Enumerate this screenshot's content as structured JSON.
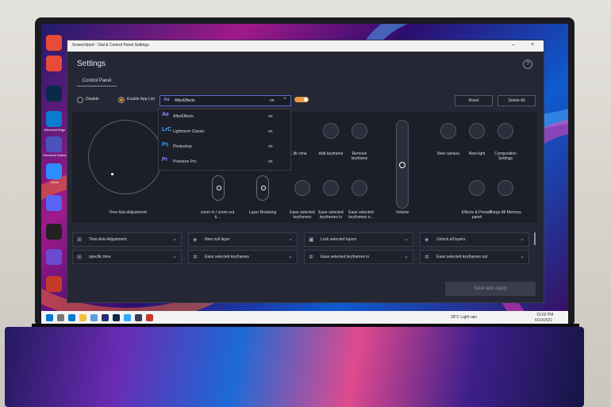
{
  "window": {
    "title": "ScreenXpert - Dial & Control Panel Settings"
  },
  "settings": {
    "heading": "Settings",
    "tab": "Control Panel",
    "disable_label": "Disable",
    "enable_label": "Enable App List",
    "selected_app": "AfterEffects",
    "selected_app_state": "on",
    "reset_label": "Reset",
    "delete_all_label": "Delete All"
  },
  "app_list": [
    {
      "badge": "Ae",
      "name": "AfterEffects",
      "state": "on",
      "color": "#9b8cff"
    },
    {
      "badge": "LrC",
      "name": "Lightroom Classic",
      "state": "on",
      "color": "#4aa3ff"
    },
    {
      "badge": "Ps",
      "name": "Photoshop",
      "state": "on",
      "color": "#31a8ff"
    },
    {
      "badge": "Pr",
      "name": "Premiere Pro",
      "state": "on",
      "color": "#9a7bff"
    }
  ],
  "controls": {
    "dial_label": "Time Axis Adjustment",
    "zoom_label": "zoom in / zoom out ti...",
    "layer_label": "Layer Browsing",
    "volume_label": "Volume",
    "buttons": [
      {
        "label": "...ific time"
      },
      {
        "label": "Add keyframe"
      },
      {
        "label": "Remove keyframe"
      },
      {
        "label": "New camera"
      },
      {
        "label": "New light"
      },
      {
        "label": "Composition Settings"
      },
      {
        "label": "Ease selected keyframes"
      },
      {
        "label": "Ease selected keyframes in"
      },
      {
        "label": "Ease selected keyframes o..."
      },
      {
        "label": "Effects & Presets panel"
      },
      {
        "label": "Purge All Memory"
      }
    ]
  },
  "assignments": [
    {
      "label": "Time Axis Adjustment"
    },
    {
      "label": "New null layer"
    },
    {
      "label": "Lock selected layers"
    },
    {
      "label": "Unlock all layers"
    },
    {
      "label": "specific time"
    },
    {
      "label": "Ease selected keyframes"
    },
    {
      "label": "Ease selected keyframes in"
    },
    {
      "label": "Ease selected keyframes out"
    }
  ],
  "save_label": "Save and Apply",
  "desktop_icons": [
    {
      "label": "Microsoft Edge"
    },
    {
      "label": "Microsoft Teams"
    },
    {
      "label": "Zoom"
    }
  ],
  "taskbar": {
    "weather": "28°C  Light rain",
    "time": "10:02 PM",
    "date": "6/10/2021"
  }
}
